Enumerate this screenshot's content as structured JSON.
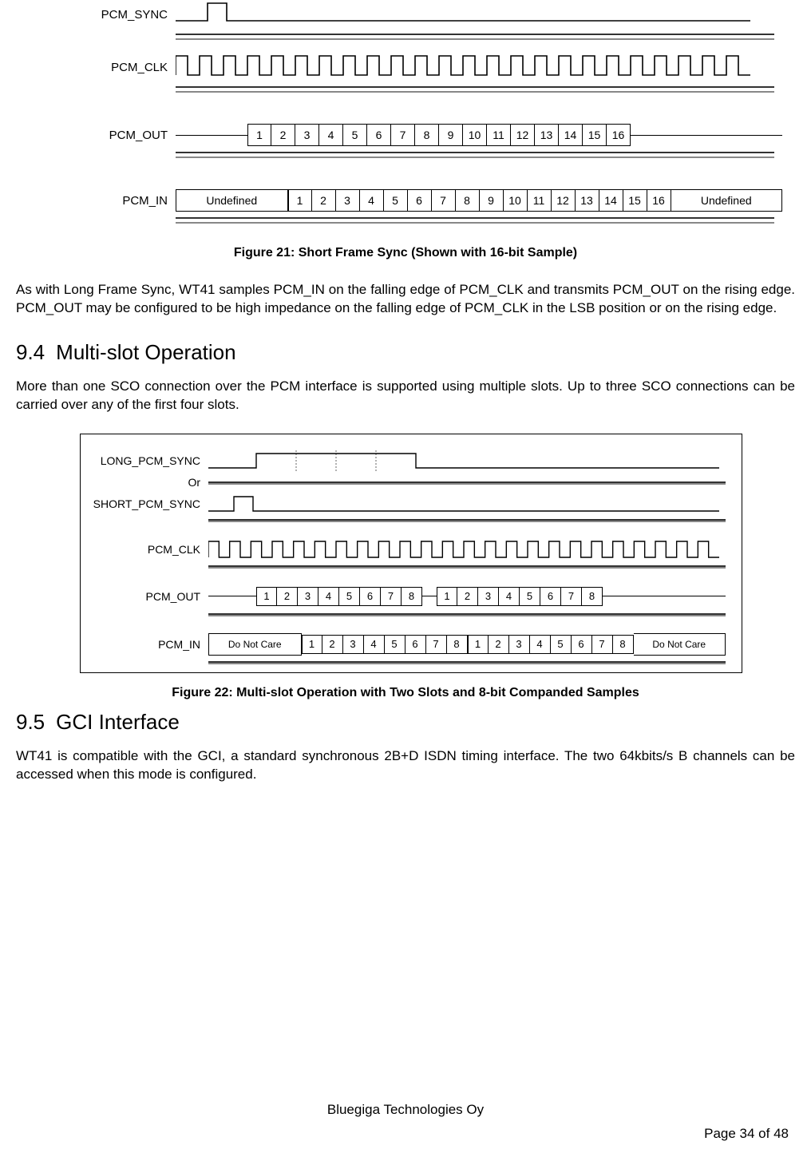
{
  "figure21": {
    "signals": {
      "sync": "PCM_SYNC",
      "clk": "PCM_CLK",
      "out": "PCM_OUT",
      "in": "PCM_IN"
    },
    "out_bits": [
      "1",
      "2",
      "3",
      "4",
      "5",
      "6",
      "7",
      "8",
      "9",
      "10",
      "11",
      "12",
      "13",
      "14",
      "15",
      "16"
    ],
    "in_left": "Undefined",
    "in_bits": [
      "1",
      "2",
      "3",
      "4",
      "5",
      "6",
      "7",
      "8",
      "9",
      "10",
      "11",
      "12",
      "13",
      "14",
      "15",
      "16"
    ],
    "in_right": "Undefined",
    "caption": "Figure 21: Short Frame Sync (Shown with 16-bit Sample)"
  },
  "para1": "As with Long Frame Sync, WT41 samples PCM_IN on the falling edge of PCM_CLK and transmits PCM_OUT on the rising edge. PCM_OUT may be configured to be high impedance on the falling edge of PCM_CLK in the LSB position or on the rising edge.",
  "sec94": {
    "num": "9.4",
    "title": "Multi-slot Operation"
  },
  "para2": "More than one SCO connection over the PCM interface is supported using multiple slots. Up to three SCO connections can be carried over any of the first four slots.",
  "figure22": {
    "labels": {
      "longsync": "LONG_PCM_SYNC",
      "or": "Or",
      "shortsync": "SHORT_PCM_SYNC",
      "clk": "PCM_CLK",
      "out": "PCM_OUT",
      "in": "PCM_IN"
    },
    "out_bits_a": [
      "1",
      "2",
      "3",
      "4",
      "5",
      "6",
      "7",
      "8"
    ],
    "out_bits_b": [
      "1",
      "2",
      "3",
      "4",
      "5",
      "6",
      "7",
      "8"
    ],
    "in_left": "Do Not Care",
    "in_bits_a": [
      "1",
      "2",
      "3",
      "4",
      "5",
      "6",
      "7",
      "8"
    ],
    "in_bits_b": [
      "1",
      "2",
      "3",
      "4",
      "5",
      "6",
      "7",
      "8"
    ],
    "in_right": "Do Not Care",
    "caption": "Figure 22: Multi-slot Operation with Two Slots and 8-bit Companded Samples"
  },
  "sec95": {
    "num": "9.5",
    "title": "GCI Interface"
  },
  "para3": "WT41 is compatible with the GCI, a standard synchronous 2B+D ISDN timing interface. The two 64kbits/s B channels can be accessed when this mode is configured.",
  "footer": {
    "company": "Bluegiga Technologies Oy",
    "page": "Page 34 of 48"
  }
}
